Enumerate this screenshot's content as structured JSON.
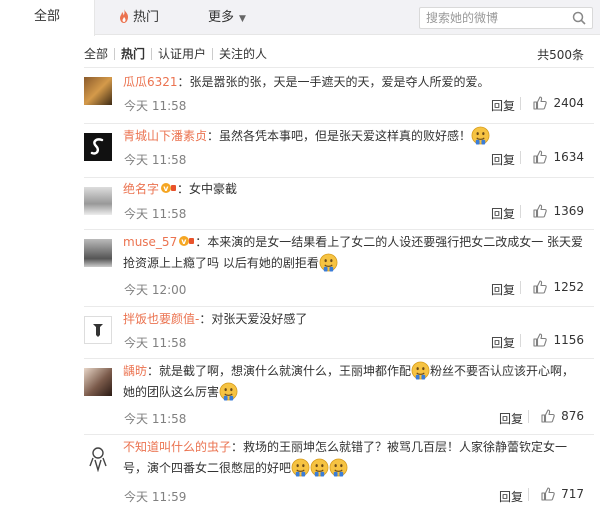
{
  "tabs": {
    "all": "全部",
    "hot": "热门",
    "more": "更多"
  },
  "search": {
    "placeholder": "搜索她的微博"
  },
  "filters": [
    "全部",
    "热门",
    "认证用户",
    "关注的人"
  ],
  "total": "共500条",
  "reply_label": "回复",
  "comments": [
    {
      "user": "瓜瓜6321",
      "text": "：张是嚣张的张，天是一手遮天的天，爱是夺人所爱的爱。",
      "time": "今天 11:58",
      "likes": "2404"
    },
    {
      "user": "青城山下潘素贞",
      "text": "：虽然各凭本事吧，但是张天爱这样真的败好感！",
      "time": "今天 11:58",
      "likes": "1634"
    },
    {
      "user": "绝名字",
      "text": "：女中豪截",
      "time": "今天 11:58",
      "likes": "1369"
    },
    {
      "user": "muse_57",
      "text": "：本来演的是女一结果看上了女二的人设还要强行把女二改成女一 张天爱抢资源上上瘾了吗 以后有她的剧拒看",
      "time": "今天 12:00",
      "likes": "1252"
    },
    {
      "user": "拌饭也要颜值-",
      "text": "：对张天爱没好感了",
      "time": "今天 11:58",
      "likes": "1156"
    },
    {
      "user": "龋昉",
      "text": "：就是截了啊，想演什么就演什么，王丽坤都作配",
      "text2": "粉丝不要否认应该开心啊，她的团队这么厉害",
      "time": "今天 11:58",
      "likes": "876"
    },
    {
      "user": "不知道叫什么的虫子",
      "text": "：救场的王丽坤怎么就错了？被骂几百层！人家徐静蕾钦定女一号，演个四番女二很憋屈的好吧",
      "time": "今天 11:59",
      "likes": "717"
    }
  ],
  "colors": {
    "username": "#eb7350",
    "time": "#808080",
    "tabbar": "#f2f2f5",
    "text": "#333333"
  },
  "icons": {
    "hot": "flame-icon",
    "search": "search-icon",
    "like": "thumb-up-icon",
    "vip": "vip-badge-icon",
    "emoji": "smiley-emoji-icon"
  }
}
